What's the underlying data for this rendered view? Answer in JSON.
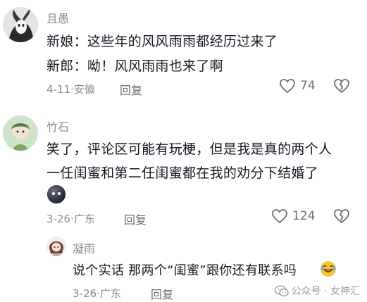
{
  "colors": {
    "text": "#161823",
    "meta": "#8a8b91",
    "action": "#6b6c72"
  },
  "comments": [
    {
      "username": "且愚",
      "lines": [
        "新娘：这些年的风风雨雨都经历过来了",
        "新郎：呦！风风雨雨也来了啊"
      ],
      "date": "4-11",
      "location": "安徽",
      "reply_label": "回复",
      "likes": "74",
      "icons": {
        "like": "heart-outline-icon",
        "dislike": "broken-heart-icon"
      }
    },
    {
      "username": "竹石",
      "lines": [
        "笑了，评论区可能有玩梗，但是我是真的两个人",
        "一任闺蜜和第二任闺蜜都在我的劝分下结婚了"
      ],
      "emoji": "round-face-sticker",
      "date": "3-26",
      "location": "广东",
      "reply_label": "回复",
      "likes": "124",
      "icons": {
        "like": "heart-outline-icon",
        "dislike": "broken-heart-icon"
      }
    },
    {
      "username": "凝雨",
      "lines": [
        "说个实话 那两个“闺蜜”跟你还有联系吗"
      ],
      "emoji": "laughing-tears-emoji",
      "date": "3-26",
      "location": "广东",
      "reply_label": "回复"
    }
  ],
  "watermark": {
    "text": "公众号 · 女神汇",
    "icon": "wechat-icon"
  }
}
